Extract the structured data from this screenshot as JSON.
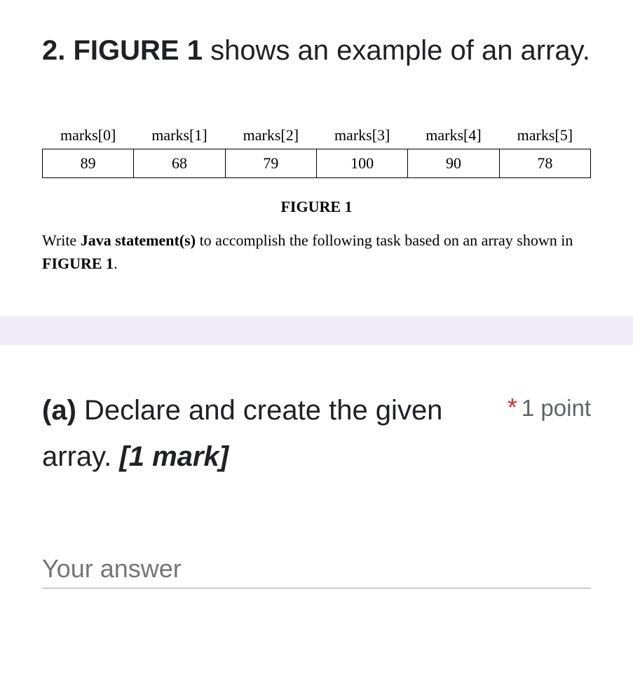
{
  "question": {
    "prefix": "2. FIGURE 1",
    "rest": " shows an example of an array."
  },
  "array": {
    "headers": [
      "marks[0]",
      "marks[1]",
      "marks[2]",
      "marks[3]",
      "marks[4]",
      "marks[5]"
    ],
    "values": [
      "89",
      "68",
      "79",
      "100",
      "90",
      "78"
    ]
  },
  "figure_caption": "FIGURE 1",
  "instruction": {
    "pre": "Write ",
    "bold1": "Java statement(s)",
    "mid": " to accomplish the following task based on an array shown in ",
    "bold2": "FIGURE 1",
    "post": "."
  },
  "subquestion": {
    "prefix": "(a)",
    "body": " Declare and create the given array. ",
    "mark": "[1 mark]"
  },
  "points": {
    "star": "*",
    "label": "1 point"
  },
  "answer_placeholder": "Your answer",
  "chart_data": {
    "type": "table",
    "title": "FIGURE 1",
    "columns": [
      "marks[0]",
      "marks[1]",
      "marks[2]",
      "marks[3]",
      "marks[4]",
      "marks[5]"
    ],
    "rows": [
      [
        89,
        68,
        79,
        100,
        90,
        78
      ]
    ]
  }
}
